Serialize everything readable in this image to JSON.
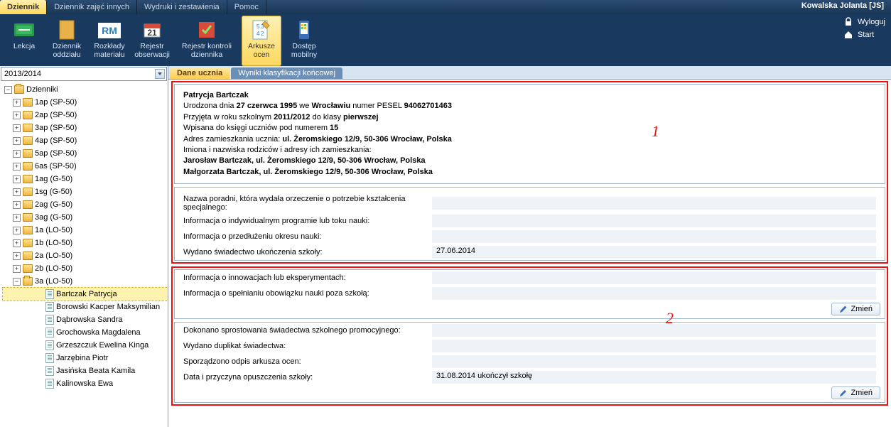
{
  "menubar": {
    "tabs": [
      "Dziennik",
      "Dziennik zajęć innych",
      "Wydruki i zestawienia",
      "Pomoc"
    ],
    "active": 0,
    "user": "Kowalska Jolanta [JS]"
  },
  "ribbon": {
    "buttons": [
      {
        "label": "Lekcja",
        "icon": "lesson-icon"
      },
      {
        "label": "Dziennik oddziału",
        "icon": "journal-icon"
      },
      {
        "label": "Rozkłady materiału",
        "icon": "rm-icon"
      },
      {
        "label": "Rejestr obserwacji",
        "icon": "register-icon"
      },
      {
        "label": "Rejestr kontroli dziennika",
        "icon": "control-icon",
        "wide": true
      },
      {
        "label": "Arkusze ocen",
        "icon": "grades-icon",
        "active": true
      },
      {
        "label": "Dostęp mobilny",
        "icon": "mobile-icon"
      }
    ],
    "right": [
      {
        "label": "Wyloguj",
        "icon": "lock-icon"
      },
      {
        "label": "Start",
        "icon": "home-icon"
      }
    ]
  },
  "year": "2013/2014",
  "tree": {
    "root": "Dzienniki",
    "classes": [
      "1ap (SP-50)",
      "2ap (SP-50)",
      "3ap (SP-50)",
      "4ap (SP-50)",
      "5ap (SP-50)",
      "6as (SP-50)",
      "1ag (G-50)",
      "1sg (G-50)",
      "2ag (G-50)",
      "3ag (G-50)",
      "1a (LO-50)",
      "1b (LO-50)",
      "2a (LO-50)",
      "2b (LO-50)",
      "3a (LO-50)"
    ],
    "expanded_index": 14,
    "students": [
      "Bartczak Patrycja",
      "Borowski Kacper Maksymilian",
      "Dąbrowska Sandra",
      "Grochowska Magdalena",
      "Grzeszczuk Ewelina Kinga",
      "Jarzębina Piotr",
      "Jasińska Beata Kamila",
      "Kalinowska Ewa"
    ],
    "selected_student_index": 0
  },
  "subtabs": {
    "items": [
      "Dane ucznia",
      "Wyniki klasyfikacji końcowej"
    ],
    "active": 0
  },
  "student": {
    "name": "Patrycja Bartczak",
    "born_prefix": "Urodzona dnia ",
    "born_date": "27 czerwca 1995",
    "born_mid": " we ",
    "born_city": "Wrocławiu",
    "pesel_prefix": " numer PESEL ",
    "pesel": "94062701463",
    "admit_prefix": "Przyjęta w roku szkolnym ",
    "admit_year": "2011/2012",
    "admit_mid": " do klasy ",
    "admit_class": "pierwszej",
    "book_prefix": "Wpisana do księgi uczniów pod numerem ",
    "book_no": "15",
    "addr_label": "Adres zamieszkania ucznia: ",
    "addr_value": "ul. Żeromskiego 12/9, 50-306 Wrocław, Polska",
    "parents_label": "Imiona i nazwiska rodziców i adresy ich zamieszkania:",
    "parent1": "Jarosław Bartczak, ul. Żeromskiego 12/9, 50-306 Wrocław, Polska",
    "parent2": "Małgorzata Bartczak, ul. Żeromskiego 12/9, 50-306 Wrocław, Polska"
  },
  "section2": {
    "rows": [
      {
        "k": "Nazwa poradni, która wydała orzeczenie o potrzebie kształcenia specjalnego:",
        "v": ""
      },
      {
        "k": "Informacja o indywidualnym programie lub toku nauki:",
        "v": ""
      },
      {
        "k": "Informacja o przedłużeniu okresu nauki:",
        "v": ""
      },
      {
        "k": "Wydano świadectwo ukończenia szkoły:",
        "v": "27.06.2014"
      }
    ]
  },
  "section3": {
    "rows": [
      {
        "k": "Informacja o innowacjach lub eksperymentach:",
        "v": ""
      },
      {
        "k": "Informacja o spełnianiu obowiązku nauki poza szkołą:",
        "v": ""
      }
    ],
    "btn": "Zmień"
  },
  "section4": {
    "rows": [
      {
        "k": "Dokonano sprostowania świadectwa szkolnego promocyjnego:",
        "v": ""
      },
      {
        "k": "Wydano duplikat świadectwa:",
        "v": ""
      },
      {
        "k": "Sporządzono odpis arkusza ocen:",
        "v": ""
      },
      {
        "k": "Data i przyczyna opuszczenia szkoły:",
        "v": "31.08.2014 ukończył szkołę"
      }
    ],
    "btn": "Zmień"
  },
  "annotations": {
    "a1": "1",
    "a2": "2"
  }
}
